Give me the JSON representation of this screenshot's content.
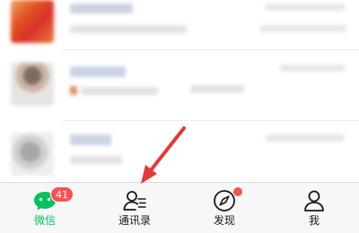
{
  "tab_bar": {
    "active_color": "#07c160",
    "badge_color": "#fa5151",
    "tabs": [
      {
        "id": "chats",
        "label": "微信",
        "icon": "chat-bubble-icon",
        "badge": "41",
        "active": true
      },
      {
        "id": "contacts",
        "label": "通讯录",
        "icon": "contacts-icon",
        "active": false
      },
      {
        "id": "discover",
        "label": "发现",
        "icon": "compass-icon",
        "red_dot": true,
        "active": false
      },
      {
        "id": "me",
        "label": "我",
        "icon": "person-icon",
        "active": false
      }
    ]
  },
  "annotation": {
    "arrow_color": "#e53935",
    "points_to": "contacts-tab"
  }
}
